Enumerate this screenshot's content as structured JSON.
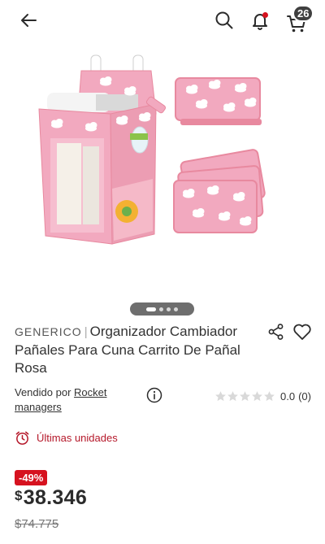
{
  "header": {
    "cart_count": "26",
    "colors": {
      "icon": "#2b2b2b",
      "notification_dot": "#d6121f",
      "badge_bg": "#3f3f3f"
    }
  },
  "gallery": {
    "image_count": 4,
    "active_index": 0,
    "image_colors": {
      "pink": "#f2a9bf",
      "pink_dark": "#e8899f",
      "white": "#ffffff"
    }
  },
  "product": {
    "brand": "GENERICO",
    "name": "Organizador Cambiador Pañales Para Cuna Carrito De Pañal Rosa",
    "seller_prefix": "Vendido por",
    "seller_name": "Rocket managers",
    "rating_value": "0.0",
    "rating_count": "(0)",
    "stars_filled": 0,
    "stock_message": "Últimas unidades",
    "discount": "-49%",
    "currency": "$",
    "price": "38.346",
    "old_price": "$74.775",
    "colors": {
      "discount_bg": "#d6121f",
      "stock_text": "#b5182a"
    }
  }
}
